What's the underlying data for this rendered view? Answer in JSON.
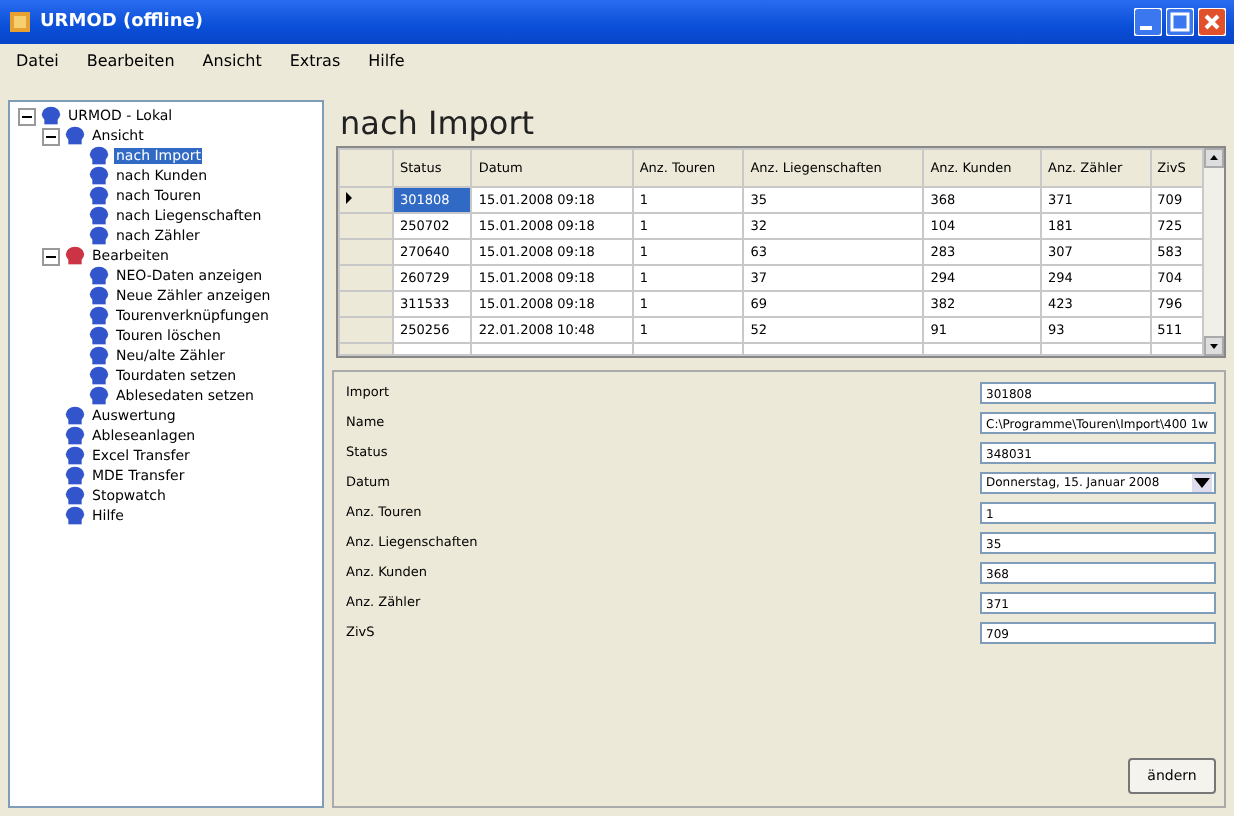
{
  "window": {
    "title": "URMOD (offline)"
  },
  "menu": [
    "Datei",
    "Bearbeiten",
    "Ansicht",
    "Extras",
    "Hilfe"
  ],
  "tree": [
    {
      "label": "URMOD - Lokal",
      "color": "#3355cc",
      "expanded": true,
      "selected": false,
      "children": [
        {
          "label": "Ansicht",
          "color": "#3355cc",
          "expanded": true,
          "selected": false,
          "children": [
            {
              "label": "nach Import",
              "color": "#3355cc",
              "selected": true
            },
            {
              "label": "nach Kunden",
              "color": "#3355cc",
              "selected": false
            },
            {
              "label": "nach Touren",
              "color": "#3355cc",
              "selected": false
            },
            {
              "label": "nach Liegenschaften",
              "color": "#3355cc",
              "selected": false
            },
            {
              "label": "nach Zähler",
              "color": "#3355cc",
              "selected": false
            }
          ]
        },
        {
          "label": "Bearbeiten",
          "color": "#cc3344",
          "expanded": true,
          "selected": false,
          "children": [
            {
              "label": "NEO-Daten anzeigen",
              "color": "#3355cc",
              "selected": false
            },
            {
              "label": "Neue Zähler anzeigen",
              "color": "#3355cc",
              "selected": false
            },
            {
              "label": "Tourenverknüpfungen",
              "color": "#3355cc",
              "selected": false
            },
            {
              "label": "Touren löschen",
              "color": "#3355cc",
              "selected": false
            },
            {
              "label": "Neu/alte Zähler",
              "color": "#3355cc",
              "selected": false
            },
            {
              "label": "Tourdaten setzen",
              "color": "#3355cc",
              "selected": false
            },
            {
              "label": "Ablesedaten setzen",
              "color": "#3355cc",
              "selected": false
            }
          ]
        },
        {
          "label": "Auswertung",
          "color": "#3355cc",
          "selected": false
        },
        {
          "label": "Ableseanlagen",
          "color": "#3355cc",
          "selected": false
        },
        {
          "label": "Excel Transfer",
          "color": "#3355cc",
          "selected": false
        },
        {
          "label": "MDE Transfer",
          "color": "#3355cc",
          "selected": false
        },
        {
          "label": "Stopwatch",
          "color": "#3355cc",
          "selected": false
        },
        {
          "label": "Hilfe",
          "color": "#3355cc",
          "selected": false
        }
      ]
    }
  ],
  "view_title": "nach Import",
  "table": {
    "columns": [
      "Status",
      "Datum",
      "Anz. Touren",
      "Anz. Liegenschaften",
      "Anz. Kunden",
      "Anz. Zähler",
      "ZivS"
    ],
    "rows": [
      {
        "selected": true,
        "cells": [
          "301808",
          "15.01.2008 09:18",
          "1",
          "35",
          "368",
          "371",
          "709"
        ]
      },
      {
        "selected": false,
        "cells": [
          "250702",
          "15.01.2008 09:18",
          "1",
          "32",
          "104",
          "181",
          "725"
        ]
      },
      {
        "selected": false,
        "cells": [
          "270640",
          "15.01.2008 09:18",
          "1",
          "63",
          "283",
          "307",
          "583"
        ]
      },
      {
        "selected": false,
        "cells": [
          "260729",
          "15.01.2008 09:18",
          "1",
          "37",
          "294",
          "294",
          "704"
        ]
      },
      {
        "selected": false,
        "cells": [
          "311533",
          "15.01.2008 09:18",
          "1",
          "69",
          "382",
          "423",
          "796"
        ]
      },
      {
        "selected": false,
        "cells": [
          "250256",
          "22.01.2008 10:48",
          "1",
          "52",
          "91",
          "93",
          "511"
        ]
      }
    ]
  },
  "details": [
    {
      "label": "Import",
      "kind": "text",
      "value": "301808"
    },
    {
      "label": "Name",
      "kind": "text",
      "value": "C:\\Programme\\Touren\\Import\\400 1w"
    },
    {
      "label": "Status",
      "kind": "text",
      "value": "348031"
    },
    {
      "label": "Datum",
      "kind": "date",
      "value": "Donnerstag, 15.   Januar   2008"
    },
    {
      "label": "Anz. Touren",
      "kind": "text",
      "value": "1"
    },
    {
      "label": "Anz. Liegenschaften",
      "kind": "text",
      "value": "35"
    },
    {
      "label": "Anz. Kunden",
      "kind": "text",
      "value": "368"
    },
    {
      "label": "Anz. Zähler",
      "kind": "text",
      "value": "371"
    },
    {
      "label": "ZivS",
      "kind": "text",
      "value": "709"
    }
  ],
  "button": "ändern"
}
